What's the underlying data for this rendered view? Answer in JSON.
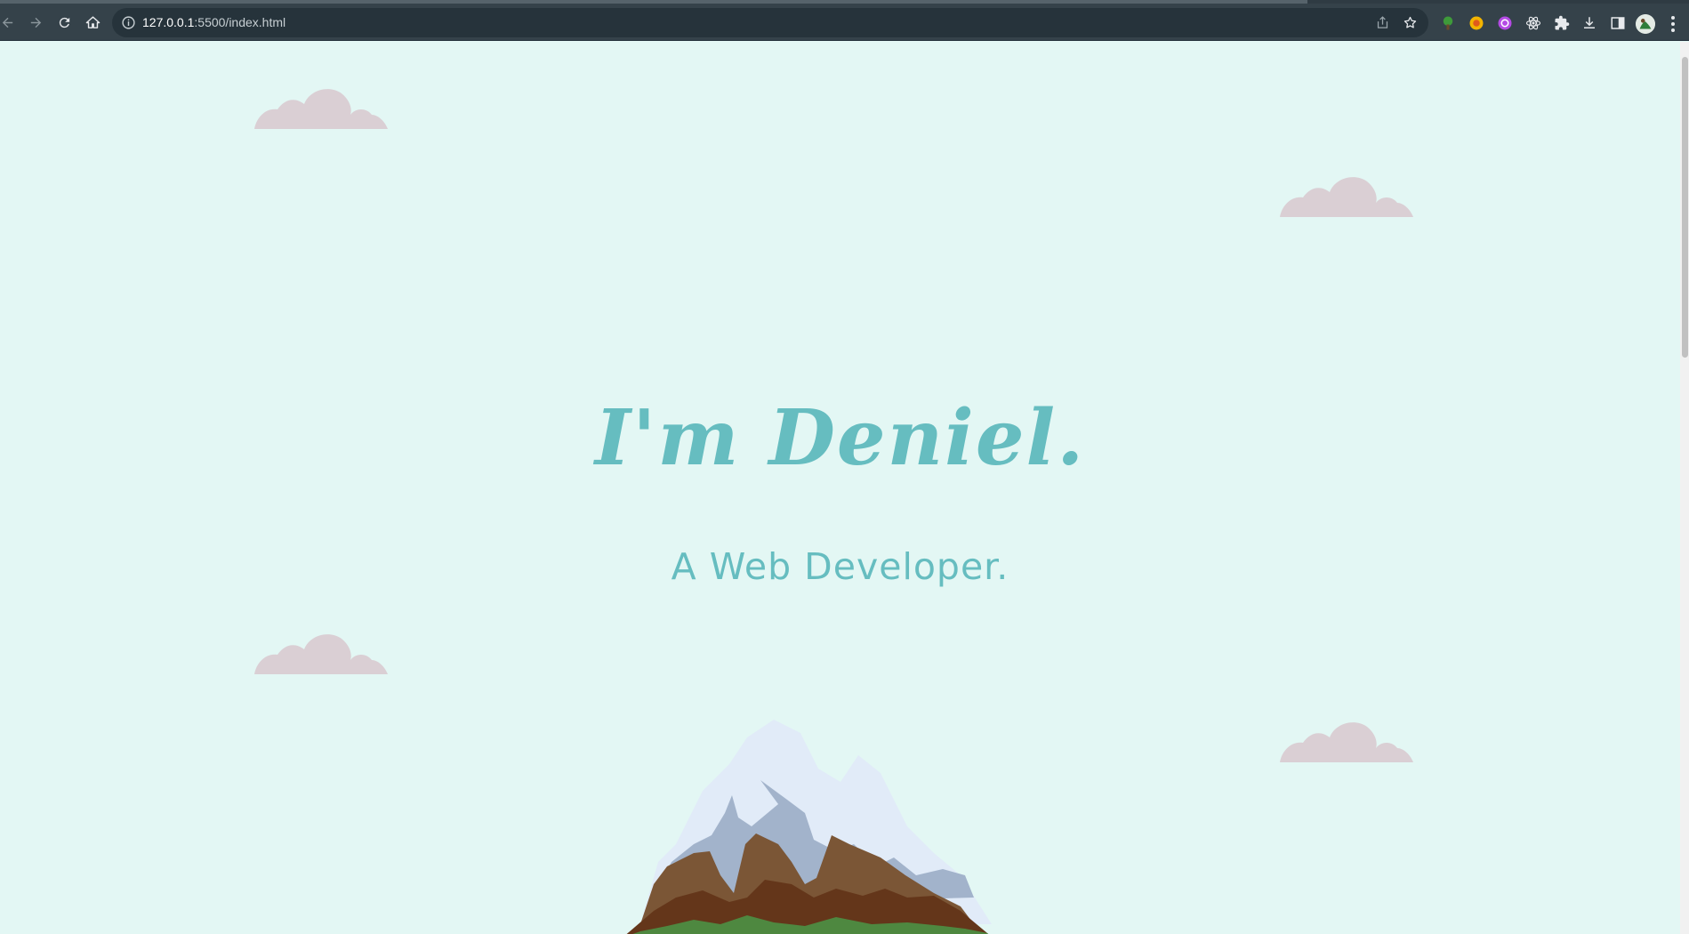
{
  "browser": {
    "url_host": "127.0.0.1",
    "url_rest": ":5500/index.html",
    "extensions": [
      "tree-extension-icon",
      "orange-extension-icon",
      "purple-extension-icon",
      "react-devtools-icon",
      "puzzle-extensions-icon"
    ]
  },
  "hero": {
    "title": "I'm Deniel.",
    "subtitle": "A Web Developer."
  },
  "colors": {
    "background": "#e3f7f4",
    "accent": "#66bdc0",
    "cloud": "#dacfd4",
    "toolbar": "#35424a"
  }
}
